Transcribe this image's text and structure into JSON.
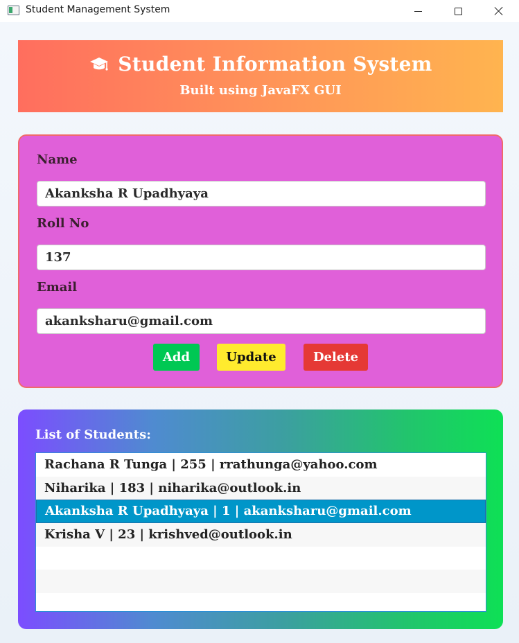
{
  "window": {
    "title": "Student Management System",
    "icon": "app-window-icon"
  },
  "header": {
    "icon": "graduation-cap-icon",
    "title": "Student Information System",
    "subtitle": "Built using JavaFX GUI"
  },
  "form": {
    "name_label": "Name",
    "name_value": "Akanksha R Upadhyaya",
    "roll_label": "Roll No",
    "roll_value": "137",
    "email_label": "Email",
    "email_value": "akanksharu@gmail.com",
    "add_label": "Add",
    "update_label": "Update",
    "delete_label": "Delete"
  },
  "list": {
    "title": "List of Students:",
    "items": [
      "Rachana R Tunga | 255 | rrathunga@yahoo.com",
      "Niharika | 183 | niharika@outlook.in",
      "Akanksha R Upadhyaya | 1 | akanksharu@gmail.com",
      "Krisha V | 23 | krishved@outlook.in"
    ],
    "selected_index": 2
  },
  "colors": {
    "add": "#00c853",
    "update": "#ffeb2e",
    "delete": "#e53935",
    "form_panel": "#e060d9",
    "selection": "#0096c9"
  }
}
